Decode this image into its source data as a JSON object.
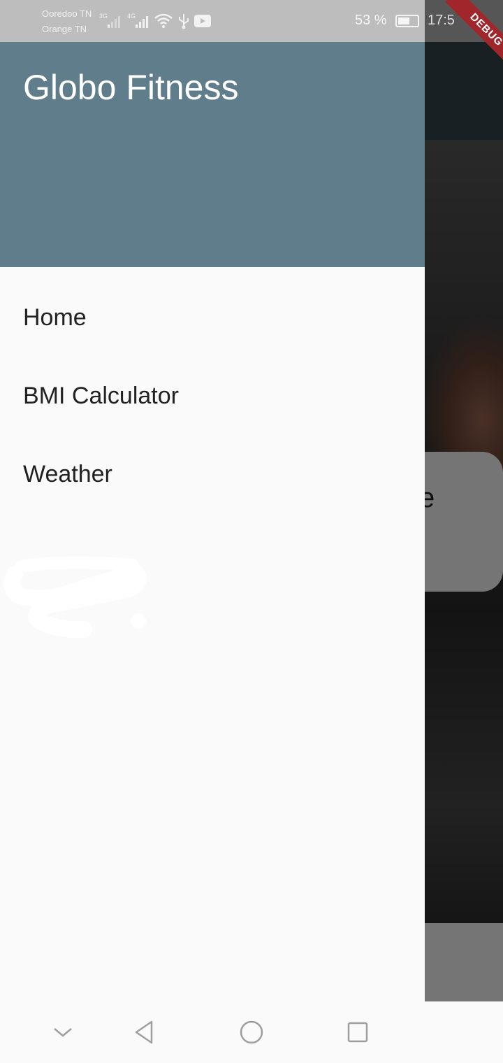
{
  "status_bar": {
    "carrier_1": "Ooredoo TN",
    "carrier_2": "Orange TN",
    "network_1": "3G",
    "network_2": "4G",
    "battery_percent": "53 %",
    "time": "17:5",
    "debug_banner": "DEBUG"
  },
  "drawer": {
    "title": "Globo Fitness",
    "header_color": "#607d8b",
    "items": [
      {
        "label": "Home"
      },
      {
        "label": "BMI Calculator"
      },
      {
        "label": "Weather"
      }
    ]
  },
  "background": {
    "card_partial_text": "e"
  },
  "nav_bar": {
    "icons": [
      "chevron-down-icon",
      "back-icon",
      "home-icon",
      "recent-apps-icon"
    ]
  }
}
